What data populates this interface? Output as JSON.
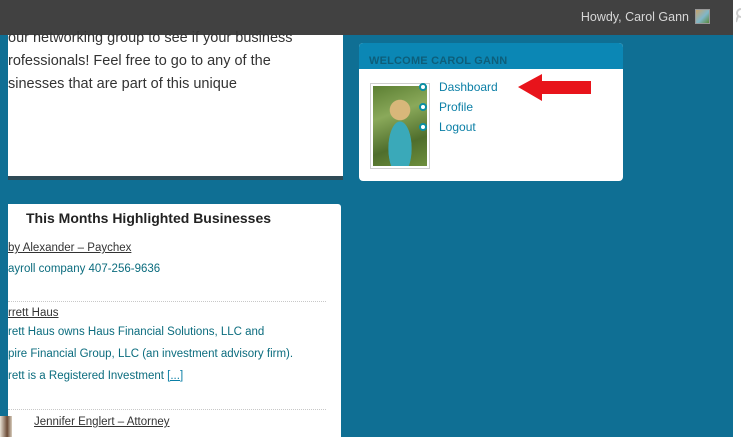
{
  "adminbar": {
    "howdy_label": "Howdy, Carol Gann"
  },
  "intro": {
    "lines": [
      "our networking group to see if your business",
      "rofessionals! Feel free to go to any of the",
      "sinesses that are part of this unique"
    ]
  },
  "welcome": {
    "title": "WELCOME CAROL GANN",
    "links": [
      "Dashboard",
      "Profile",
      "Logout"
    ]
  },
  "businesses": {
    "title": "This Months Highlighted Businesses",
    "entries": [
      {
        "name": "by Alexander – Paychex",
        "desc": [
          "ayroll company 407-256-9636"
        ]
      },
      {
        "name": "rrett Haus",
        "desc": [
          "rett Haus owns Haus Financial Solutions, LLC and",
          "pire Financial Group, LLC (an investment advisory firm).",
          "rett is a Registered Investment"
        ],
        "more": "[...]"
      },
      {
        "name": "Jennifer Englert – Attorney",
        "desc": []
      }
    ]
  },
  "colors": {
    "page_bg": "#0f6f94",
    "adminbar_bg": "#414141",
    "widget_header": "#0b87b5",
    "arrow": "#e8141b"
  },
  "icons": {
    "search": "search-icon",
    "arrow": "red-arrow-icon"
  }
}
